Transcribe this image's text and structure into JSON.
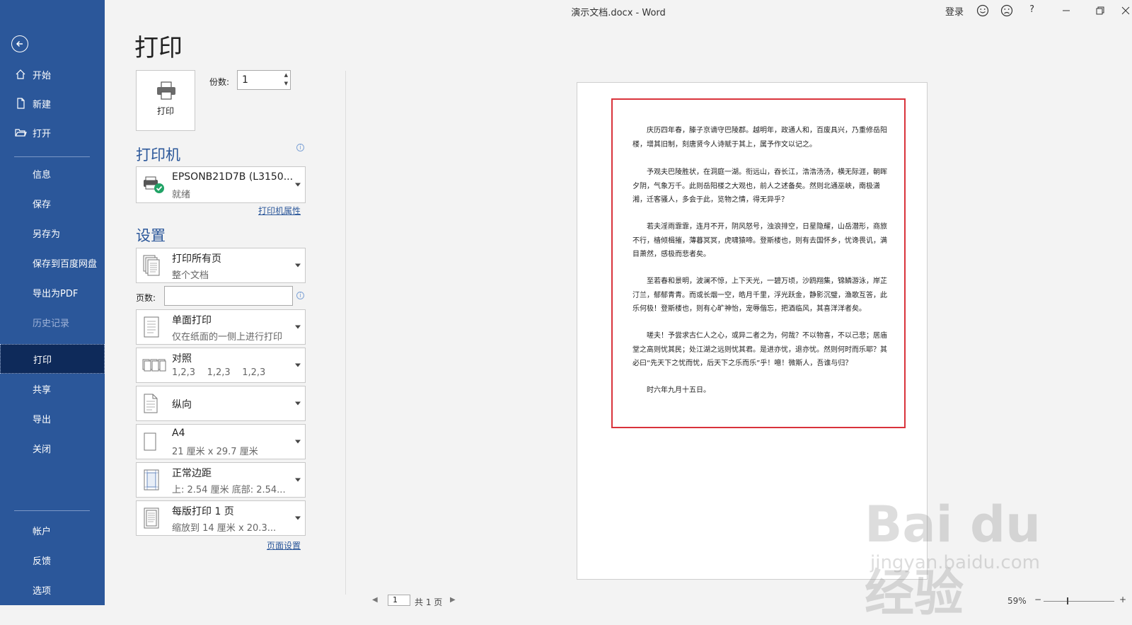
{
  "window": {
    "title": "演示文档.docx  -  Word",
    "login": "登录",
    "help": "?"
  },
  "sidebar": {
    "items": [
      {
        "label": "开始"
      },
      {
        "label": "新建"
      },
      {
        "label": "打开"
      },
      {
        "label": "信息"
      },
      {
        "label": "保存"
      },
      {
        "label": "另存为"
      },
      {
        "label": "保存到百度网盘"
      },
      {
        "label": "导出为PDF"
      },
      {
        "label": "历史记录"
      },
      {
        "label": "打印"
      },
      {
        "label": "共享"
      },
      {
        "label": "导出"
      },
      {
        "label": "关闭"
      },
      {
        "label": "帐户"
      },
      {
        "label": "反馈"
      },
      {
        "label": "选项"
      }
    ]
  },
  "print": {
    "title": "打印",
    "button_label": "打印",
    "copies_label": "份数:",
    "copies_value": "1",
    "printer_heading": "打印机",
    "printer_name": "EPSONB21D7B (L3150...",
    "printer_status": "就绪",
    "printer_props_link": "打印机属性",
    "settings_heading": "设置",
    "settings": [
      {
        "l1": "打印所有页",
        "l2": "整个文档"
      },
      {
        "l1": "单面打印",
        "l2": "仅在纸面的一侧上进行打印"
      },
      {
        "l1": "对照",
        "l2": "1,2,3    1,2,3    1,2,3"
      },
      {
        "l1": "纵向",
        "l2": ""
      },
      {
        "l1": "A4",
        "l2": "21 厘米 x 29.7 厘米"
      },
      {
        "l1": "正常边距",
        "l2": "上: 2.54 厘米 底部: 2.54..."
      },
      {
        "l1": "每版打印 1 页",
        "l2": "缩放到 14 厘米 x 20.3..."
      }
    ],
    "pages_label": "页数:",
    "page_setup_link": "页面设置"
  },
  "preview": {
    "paragraphs": [
      "庆历四年春，滕子京谪守巴陵郡。越明年，政通人和，百废具兴，乃重修岳阳楼，增其旧制，刻唐贤今人诗赋于其上，属予作文以记之。",
      "予观夫巴陵胜状，在洞庭一湖。衔远山，吞长江，浩浩汤汤，横无际涯，朝晖夕阴，气象万千。此则岳阳楼之大观也，前人之述备矣。然则北通巫峡，南极潇湘，迁客骚人，多会于此，览物之情，得无异乎？",
      "若夫淫雨霏霏，连月不开，阴风怒号，浊浪排空，日星隐耀，山岳潜形，商旅不行，樯倾楫摧，薄暮冥冥，虎啸猿啼。登斯楼也，则有去国怀乡，忧谗畏讥，满目萧然，感极而悲者矣。",
      "至若春和景明，波澜不惊，上下天光，一碧万顷，沙鸥翔集，锦鳞游泳，岸芷汀兰，郁郁青青。而或长烟一空，皓月千里，浮光跃金，静影沉璧，渔歌互答，此乐何极！登斯楼也，则有心旷神怡，宠辱偕忘，把酒临风，其喜洋洋者矣。",
      "嗟夫！予尝求古仁人之心，或异二者之为，何哉？不以物喜，不以己悲；居庙堂之高则忧其民；处江湖之远则忧其君。是进亦忧，退亦忧。然则何时而乐耶？其必曰“先天下之忧而忧，后天下之乐而乐”乎！噫！微斯人，吾谁与归？",
      "时六年九月十五日。"
    ],
    "page_input": "1",
    "page_total": "共 1 页",
    "zoom": "59%"
  },
  "watermark": {
    "text": "Bai du 经验",
    "sub": "jingyan.baidu.com"
  }
}
